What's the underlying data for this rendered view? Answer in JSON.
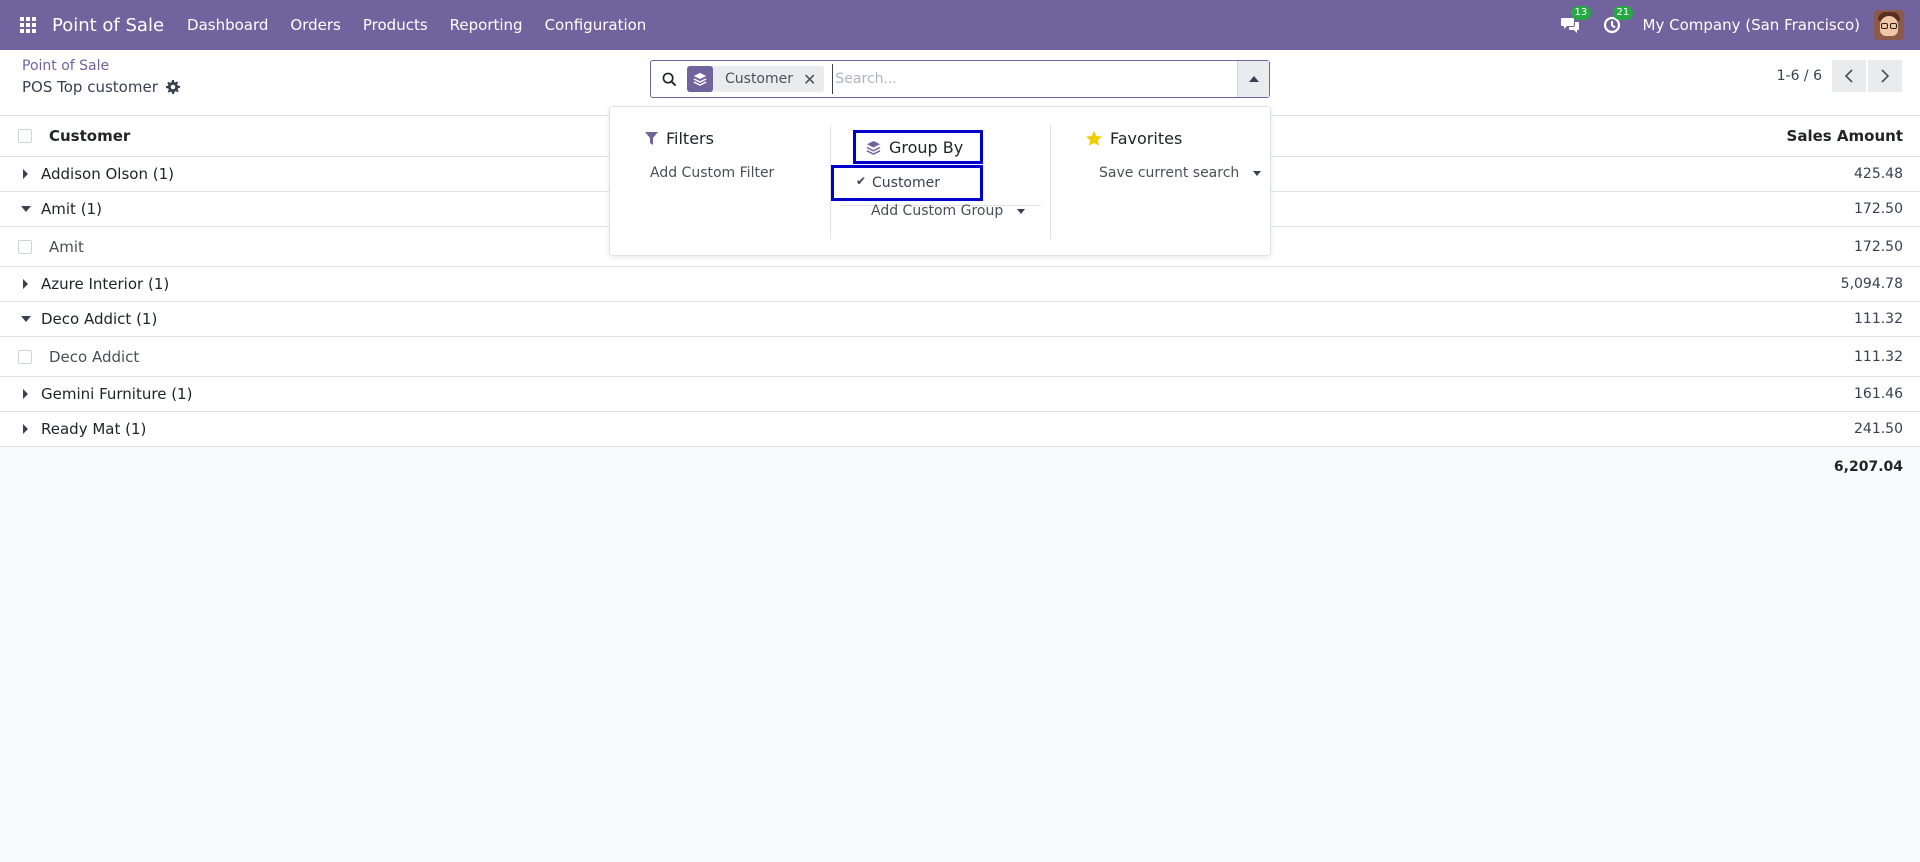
{
  "navbar": {
    "app_name": "Point of Sale",
    "menu": [
      "Dashboard",
      "Orders",
      "Products",
      "Reporting",
      "Configuration"
    ],
    "messages_count": "13",
    "activities_count": "21",
    "company": "My Company (San Francisco)"
  },
  "control": {
    "breadcrumb": "Point of Sale",
    "title": "POS Top customer",
    "search": {
      "facet_value": "Customer",
      "placeholder": "Search..."
    },
    "pager": "1-6 / 6"
  },
  "dropdown": {
    "filters": {
      "title": "Filters",
      "add_custom": "Add Custom Filter"
    },
    "group_by": {
      "title": "Group By",
      "selected": "Customer",
      "add_custom": "Add Custom Group"
    },
    "favorites": {
      "title": "Favorites",
      "save": "Save current search"
    }
  },
  "list": {
    "headers": {
      "customer": "Customer",
      "amount": "Sales Amount"
    },
    "rows": [
      {
        "kind": "group",
        "open": false,
        "label": "Addison Olson (1)",
        "amount": "425.48"
      },
      {
        "kind": "group",
        "open": true,
        "label": "Amit (1)",
        "amount": "172.50"
      },
      {
        "kind": "record",
        "label": "Amit",
        "amount": "172.50"
      },
      {
        "kind": "group",
        "open": false,
        "label": "Azure Interior (1)",
        "amount": "5,094.78"
      },
      {
        "kind": "group",
        "open": true,
        "label": "Deco Addict (1)",
        "amount": "111.32"
      },
      {
        "kind": "record",
        "label": "Deco Addict",
        "amount": "111.32"
      },
      {
        "kind": "group",
        "open": false,
        "label": "Gemini Furniture (1)",
        "amount": "161.46"
      },
      {
        "kind": "group",
        "open": false,
        "label": "Ready Mat (1)",
        "amount": "241.50"
      }
    ],
    "total": "6,207.04"
  },
  "colors": {
    "brand": "#71639e",
    "highlight": "#0000cc",
    "badge": "#28a745",
    "star": "#f3cc00"
  }
}
